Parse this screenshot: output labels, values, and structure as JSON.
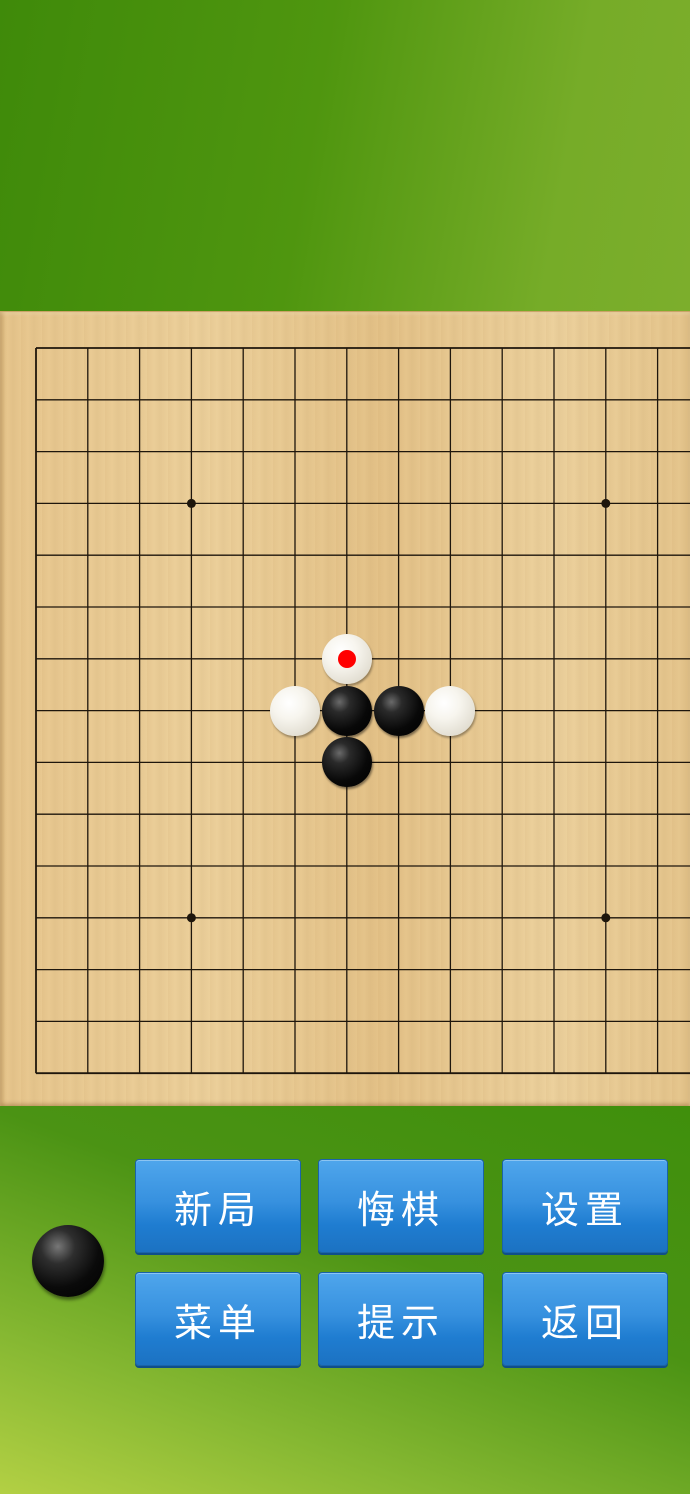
{
  "board": {
    "rows": 15,
    "cols": 14,
    "star_points": [
      [
        3,
        3
      ],
      [
        3,
        11
      ],
      [
        11,
        3
      ],
      [
        11,
        11
      ]
    ],
    "stones": [
      {
        "row": 6,
        "col": 6,
        "color": "white",
        "last_move": true
      },
      {
        "row": 7,
        "col": 5,
        "color": "white",
        "last_move": false
      },
      {
        "row": 7,
        "col": 6,
        "color": "black",
        "last_move": false
      },
      {
        "row": 7,
        "col": 7,
        "color": "black",
        "last_move": false
      },
      {
        "row": 7,
        "col": 8,
        "color": "white",
        "last_move": false
      },
      {
        "row": 8,
        "col": 6,
        "color": "black",
        "last_move": false
      }
    ],
    "last_move_marker_color": "#ff0000"
  },
  "current_turn": "black",
  "buttons": {
    "new_game": "新局",
    "undo": "悔棋",
    "settings": "设置",
    "menu": "菜单",
    "hint": "提示",
    "back": "返回"
  },
  "colors": {
    "background_green": "#4a8c12",
    "button_blue": "#2c87d8",
    "board_wood": "#e8c991"
  }
}
